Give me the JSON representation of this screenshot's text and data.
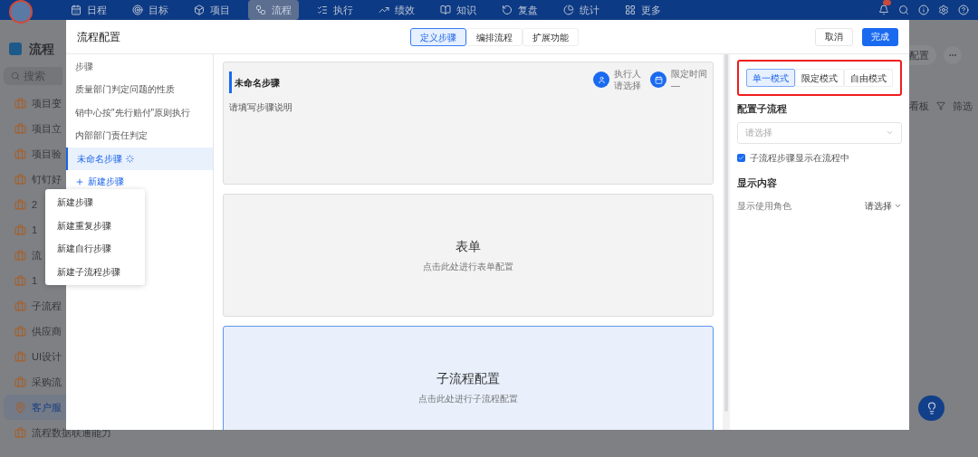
{
  "nav": {
    "items": [
      {
        "label": "日程",
        "selected": false
      },
      {
        "label": "目标",
        "selected": false
      },
      {
        "label": "项目",
        "selected": false
      },
      {
        "label": "流程",
        "selected": true
      },
      {
        "label": "执行",
        "selected": false
      },
      {
        "label": "绩效",
        "selected": false
      },
      {
        "label": "知识",
        "selected": false
      },
      {
        "label": "复盘",
        "selected": false
      },
      {
        "label": "统计",
        "selected": false
      },
      {
        "label": "更多",
        "selected": false
      }
    ]
  },
  "app_sidebar": {
    "title": "流程",
    "search_placeholder": "搜索",
    "items": [
      {
        "label": "项目变",
        "selected": false
      },
      {
        "label": "项目立",
        "selected": false
      },
      {
        "label": "项目验",
        "selected": false
      },
      {
        "label": "钉钉好",
        "selected": false
      },
      {
        "label": "2",
        "selected": false
      },
      {
        "label": "1",
        "selected": false
      },
      {
        "label": "流",
        "selected": false
      },
      {
        "label": "1",
        "selected": false
      },
      {
        "label": "子流程",
        "selected": false
      },
      {
        "label": "供应商",
        "selected": false
      },
      {
        "label": "UI设计",
        "selected": false
      },
      {
        "label": "采购流",
        "selected": false
      },
      {
        "label": "客户服",
        "selected": true
      },
      {
        "label": "流程数据联通能力",
        "selected": false
      }
    ]
  },
  "background_toolbar": {
    "config_button": "配置",
    "view": "看板",
    "filter": "筛选"
  },
  "dialog": {
    "title": "流程配置",
    "tabs": [
      {
        "label": "定义步骤",
        "selected": true
      },
      {
        "label": "编排流程",
        "selected": false
      },
      {
        "label": "扩展功能",
        "selected": false
      }
    ],
    "cancel": "取消",
    "done": "完成",
    "steps": {
      "header": "步骤",
      "items": [
        {
          "label": "质量部门判定问题的性质",
          "selected": false,
          "loading": false
        },
        {
          "label": "销中心按\"先行赔付\"原则执行",
          "selected": false,
          "loading": false
        },
        {
          "label": "内部部门责任判定",
          "selected": false,
          "loading": false
        },
        {
          "label": "未命名步骤",
          "selected": true,
          "loading": true
        }
      ],
      "add_step": "新建步骤",
      "menu": [
        "新建步骤",
        "新建重复步骤",
        "新建自行步骤",
        "新建子流程步骤"
      ]
    },
    "step_card": {
      "title": "未命名步骤",
      "description_placeholder": "请填写步骤说明",
      "assignee": {
        "label": "执行人",
        "value": "请选择"
      },
      "deadline": {
        "label": "限定时间",
        "value": "—"
      }
    },
    "sections": [
      {
        "title": "表单",
        "hint": "点击此处进行表单配置",
        "selected": false
      },
      {
        "title": "子流程配置",
        "hint": "点击此处进行子流程配置",
        "selected": true
      }
    ],
    "settings": {
      "modes": [
        {
          "label": "单一模式",
          "selected": true
        },
        {
          "label": "限定模式",
          "selected": false
        },
        {
          "label": "自由模式",
          "selected": false
        }
      ],
      "modes_highlighted": true,
      "subflow_heading": "配置子流程",
      "subflow_select_placeholder": "请选择",
      "show_in_flow": {
        "label": "子流程步骤显示在流程中",
        "checked": true
      },
      "display_heading": "显示内容",
      "role_row": {
        "label": "显示使用角色",
        "value": "请选择"
      }
    }
  }
}
